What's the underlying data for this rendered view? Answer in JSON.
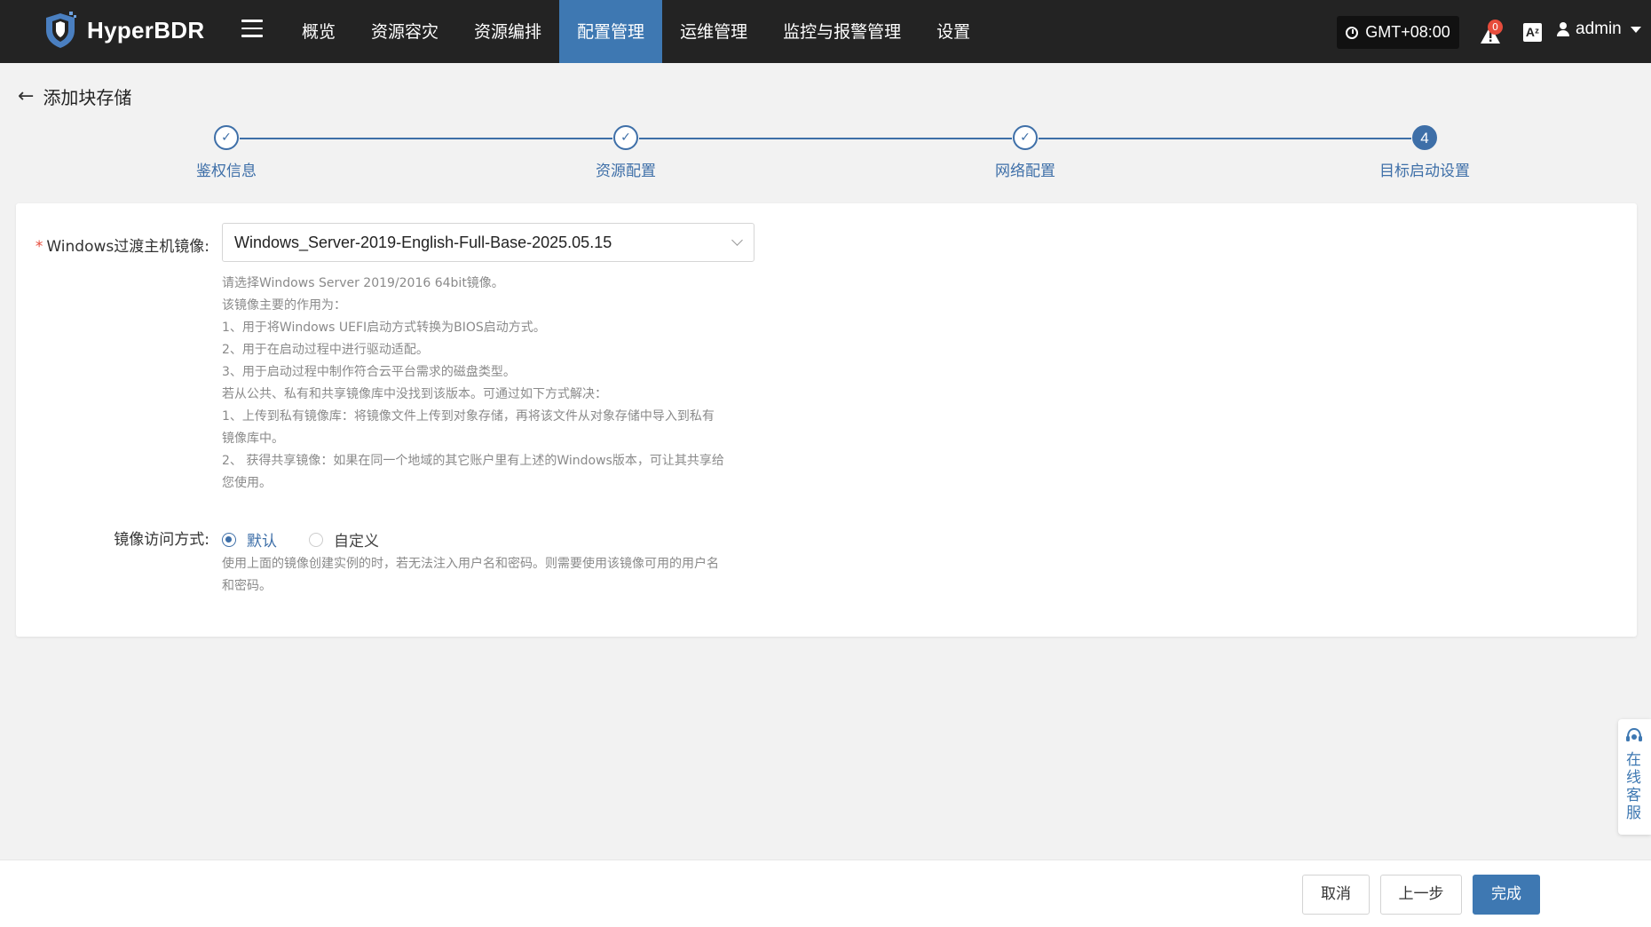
{
  "app": {
    "name": "HyperBDR"
  },
  "nav": {
    "items": [
      "概览",
      "资源容灾",
      "资源编排",
      "配置管理",
      "运维管理",
      "监控与报警管理",
      "设置"
    ],
    "active_index": 3
  },
  "header": {
    "timezone": "GMT+08:00",
    "alert_count": "0",
    "lang_glyph": "Aᶻ",
    "user": "admin"
  },
  "page": {
    "title": "添加块存储",
    "back_glyph": "←"
  },
  "steps": {
    "items": [
      {
        "label": "鉴权信息",
        "status": "done",
        "marker": "✓"
      },
      {
        "label": "资源配置",
        "status": "done",
        "marker": "✓"
      },
      {
        "label": "网络配置",
        "status": "done",
        "marker": "✓"
      },
      {
        "label": "目标启动设置",
        "status": "current",
        "marker": "4"
      }
    ]
  },
  "form": {
    "image_field": {
      "required_mark": "*",
      "label": "Windows过渡主机镜像:",
      "value": "Windows_Server-2019-English-Full-Base-2025.05.15",
      "help_lines": [
        "请选择Windows Server 2019/2016 64bit镜像。",
        "该镜像主要的作用为：",
        "1、用于将Windows UEFI启动方式转换为BIOS启动方式。",
        "2、用于在启动过程中进行驱动适配。",
        "3、用于启动过程中制作符合云平台需求的磁盘类型。",
        "若从公共、私有和共享镜像库中没找到该版本。可通过如下方式解决：",
        "1、上传到私有镜像库：将镜像文件上传到对象存储，再将该文件从对象存储中导入到私有",
        "镜像库中。",
        "2、 获得共享镜像：如果在同一个地域的其它账户里有上述的Windows版本，可让其共享给",
        "您使用。"
      ]
    },
    "access_field": {
      "label": "镜像访问方式:",
      "options": [
        "默认",
        "自定义"
      ],
      "selected": "默认",
      "help_lines": [
        "使用上面的镜像创建实例的时，若无法注入用户名和密码。则需要使用该镜像可用的用户名",
        "和密码。"
      ]
    }
  },
  "footer": {
    "cancel": "取消",
    "prev": "上一步",
    "finish": "完成"
  },
  "service": {
    "label": "在线客服"
  },
  "colors": {
    "primary": "#3e78b2",
    "topbar": "#232323",
    "badge": "#e74c3c"
  }
}
